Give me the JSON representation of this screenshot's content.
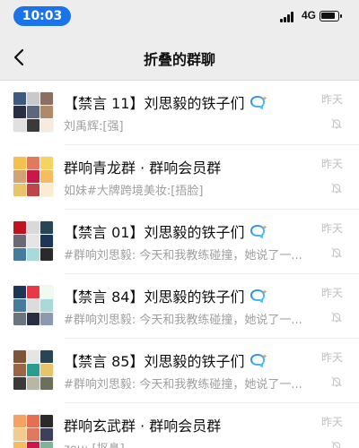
{
  "status_bar": {
    "time": "10:03",
    "network": "4G"
  },
  "nav": {
    "title": "折叠的群聊"
  },
  "chats": [
    {
      "name": "【禁言 11】刘思毅的铁子们",
      "preview": "刘禹辉:[强]",
      "time": "昨天",
      "has_ai_bubble": true,
      "avatar_colors": [
        "#3d5a80",
        "#c9c9c9",
        "#8d6e63",
        "#2b2d42",
        "#5c677d",
        "#b08968",
        "#e0e0e0",
        "#3a3a3a",
        "#f5ebe0"
      ]
    },
    {
      "name": "群响青龙群 · 群响会员群",
      "preview": "如妹#大牌跨境美妆:[捂脸]",
      "time": "昨天",
      "has_ai_bubble": false,
      "avatar_colors": [
        "#f2c14e",
        "#e07a5f",
        "#f4d35e",
        "#d4a373",
        "#c9184a",
        "#f6bd60",
        "#e9c46a",
        "#bc4749",
        "#faedcd"
      ]
    },
    {
      "name": "【禁言 01】刘思毅的铁子们",
      "preview": "#群响刘思毅: 今天和我教练碰撞，她说了一...",
      "time": "昨天",
      "has_ai_bubble": true,
      "avatar_colors": [
        "#c1121f",
        "#d9d9d9",
        "#264653",
        "#6d6875",
        "#e5e5e5",
        "#1d3557",
        "#457b9d",
        "#a8dadc",
        "#2a2a2a"
      ]
    },
    {
      "name": "【禁言 84】刘思毅的铁子们",
      "preview": "#群响刘思毅: 今天和我教练碰撞，她说了一...",
      "time": "昨天",
      "has_ai_bubble": true,
      "avatar_colors": [
        "#1d3557",
        "#e63946",
        "#f1faee",
        "#457b9d",
        "#dcdcdc",
        "#a8dadc",
        "#6c757d",
        "#2b2d42",
        "#8d99ae"
      ]
    },
    {
      "name": "【禁言 85】刘思毅的铁子们",
      "preview": "#群响刘思毅: 今天和我教练碰撞，她说了一...",
      "time": "昨天",
      "has_ai_bubble": true,
      "avatar_colors": [
        "#7f5539",
        "#e5e5e5",
        "#264653",
        "#9c6644",
        "#2a9d8f",
        "#e9c46a",
        "#3a3a3a",
        "#b7b7a4",
        "#6b705c"
      ]
    },
    {
      "name": "群响玄武群 · 群响会员群",
      "preview": "zou: [抠鼻]",
      "time": "昨天",
      "has_ai_bubble": false,
      "avatar_colors": [
        "#f4a261",
        "#e76f51",
        "#2a2a2a",
        "#f2cc8f",
        "#e07a5f",
        "#3d405b",
        "#f6bd60",
        "#c9184a",
        "#81b29a"
      ]
    }
  ]
}
